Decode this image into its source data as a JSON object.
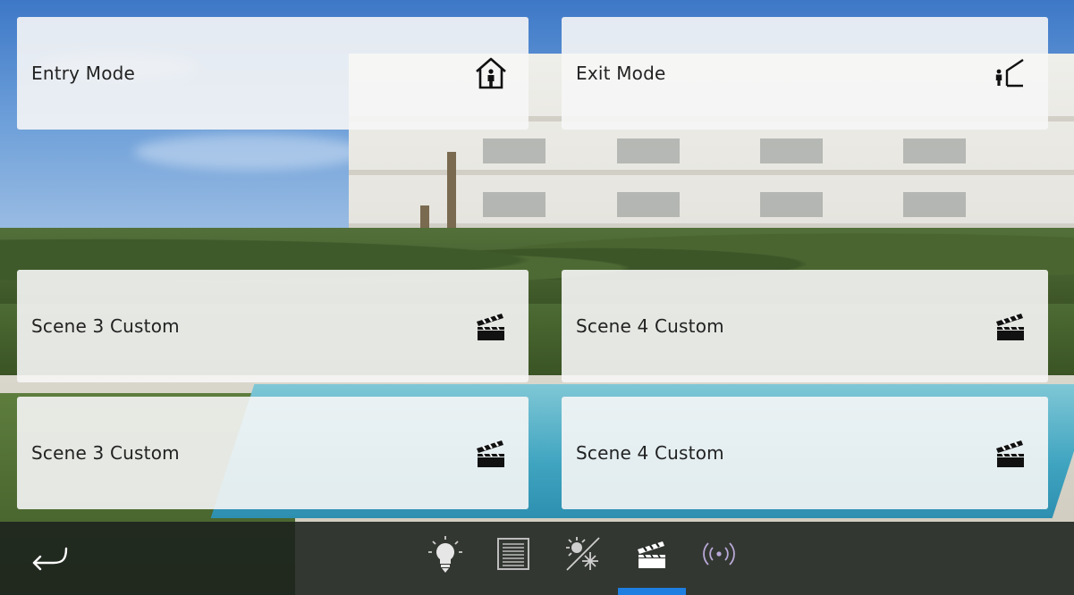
{
  "tiles": {
    "entry_mode": {
      "label": "Entry Mode",
      "icon": "house-person-icon"
    },
    "exit_mode": {
      "label": "Exit Mode",
      "icon": "person-leaving-house-icon"
    },
    "scene_row2_left": {
      "label": "Scene 3 Custom",
      "icon": "clapperboard-icon"
    },
    "scene_row2_right": {
      "label": "Scene 4 Custom",
      "icon": "clapperboard-icon"
    },
    "scene_row3_left": {
      "label": "Scene 3 Custom",
      "icon": "clapperboard-icon"
    },
    "scene_row3_right": {
      "label": "Scene 4 Custom",
      "icon": "clapperboard-icon"
    }
  },
  "bottom_nav": {
    "back_icon": "back-arrow-icon",
    "items": [
      {
        "icon": "light-bulb-icon",
        "active": false
      },
      {
        "icon": "blinds-icon",
        "active": false
      },
      {
        "icon": "climate-sun-snow-icon",
        "active": false
      },
      {
        "icon": "clapperboard-icon",
        "active": true
      },
      {
        "icon": "wireless-signal-icon",
        "active": false
      }
    ]
  },
  "colors": {
    "accent": "#1e7fe0",
    "tile_bg": "#f6f6f6",
    "bar_bg": "#1c221e"
  }
}
